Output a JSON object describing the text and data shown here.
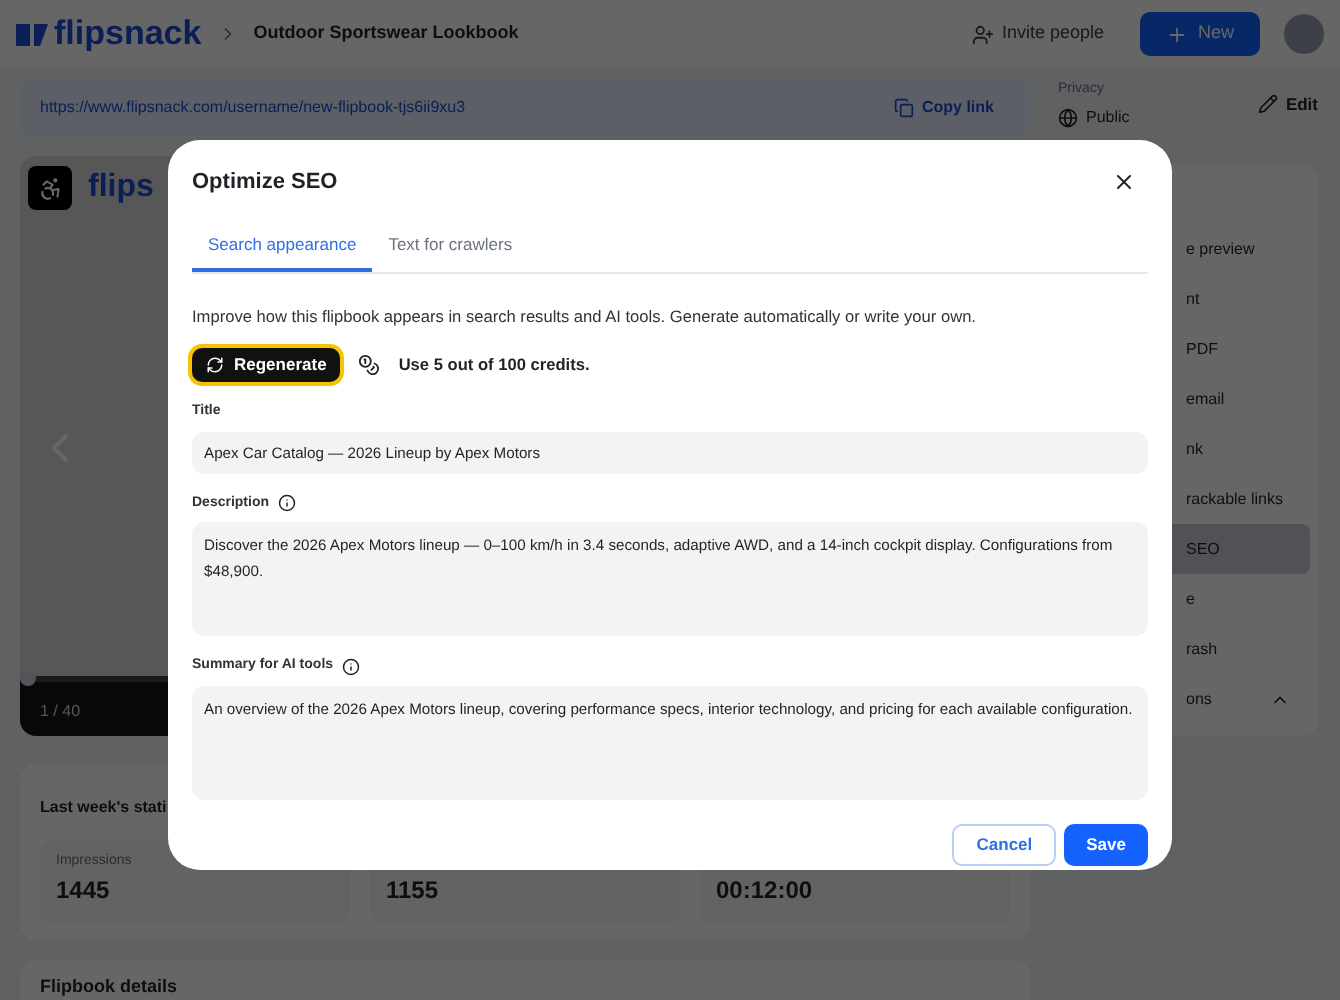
{
  "header": {
    "logo": "flipsnack",
    "title": "Outdoor Sportswear Lookbook",
    "invite": "Invite people",
    "new_button": "New"
  },
  "link_bar": {
    "url": "https://www.flipsnack.com/username/new-flipbook-tjs6ii9xu3",
    "copy": "Copy link"
  },
  "privacy": {
    "label": "Privacy",
    "value": "Public",
    "edit": "Edit"
  },
  "viewer": {
    "logo": "flips",
    "page_counter": "1 / 40",
    "level": 0
  },
  "sidebar": {
    "items": [
      {
        "label": "e preview",
        "selected": false
      },
      {
        "label": "nt",
        "selected": false
      },
      {
        "label": "PDF",
        "selected": false
      },
      {
        "label": "email",
        "selected": false
      },
      {
        "label": "nk",
        "selected": false
      },
      {
        "label": "rackable links",
        "selected": false
      },
      {
        "label": "SEO",
        "selected": true
      },
      {
        "label": "e",
        "selected": false
      },
      {
        "label": "rash",
        "selected": false
      },
      {
        "label": "ons",
        "selected": false,
        "expanded": true
      }
    ]
  },
  "stats": {
    "title": "Last week's stati",
    "metrics": [
      {
        "label": "Impressions",
        "value": "1445"
      },
      {
        "value": "1155"
      },
      {
        "value": "00:12:00"
      }
    ]
  },
  "details": {
    "title": "Flipbook details"
  },
  "modal": {
    "title": "Optimize SEO",
    "tabs": [
      {
        "label": "Search appearance",
        "selected": true
      },
      {
        "label": "Text for crawlers",
        "selected": false
      }
    ],
    "intro": "Improve how this flipbook appears in search results and AI tools. Generate automatically or write your own.",
    "regenerate": "Regenerate",
    "credits": "Use 5 out of 100 credits.",
    "fields": [
      {
        "kind": "input",
        "label": "Title",
        "info": false,
        "value": "Apex Car Catalog — 2026 Lineup by Apex Motors"
      },
      {
        "kind": "textarea",
        "label": "Description",
        "info": true,
        "value": "Discover the 2026 Apex Motors lineup — 0–100 km/h in 3.4 seconds, adaptive AWD, and a 14-inch cockpit display. Configurations from $48,900."
      },
      {
        "kind": "textarea",
        "label": "Summary for AI tools",
        "info": true,
        "value": "An overview of the 2026 Apex Motors lineup, covering performance specs, interior technology, and pricing for each available configuration."
      }
    ],
    "cancel": "Cancel",
    "save": "Save"
  }
}
